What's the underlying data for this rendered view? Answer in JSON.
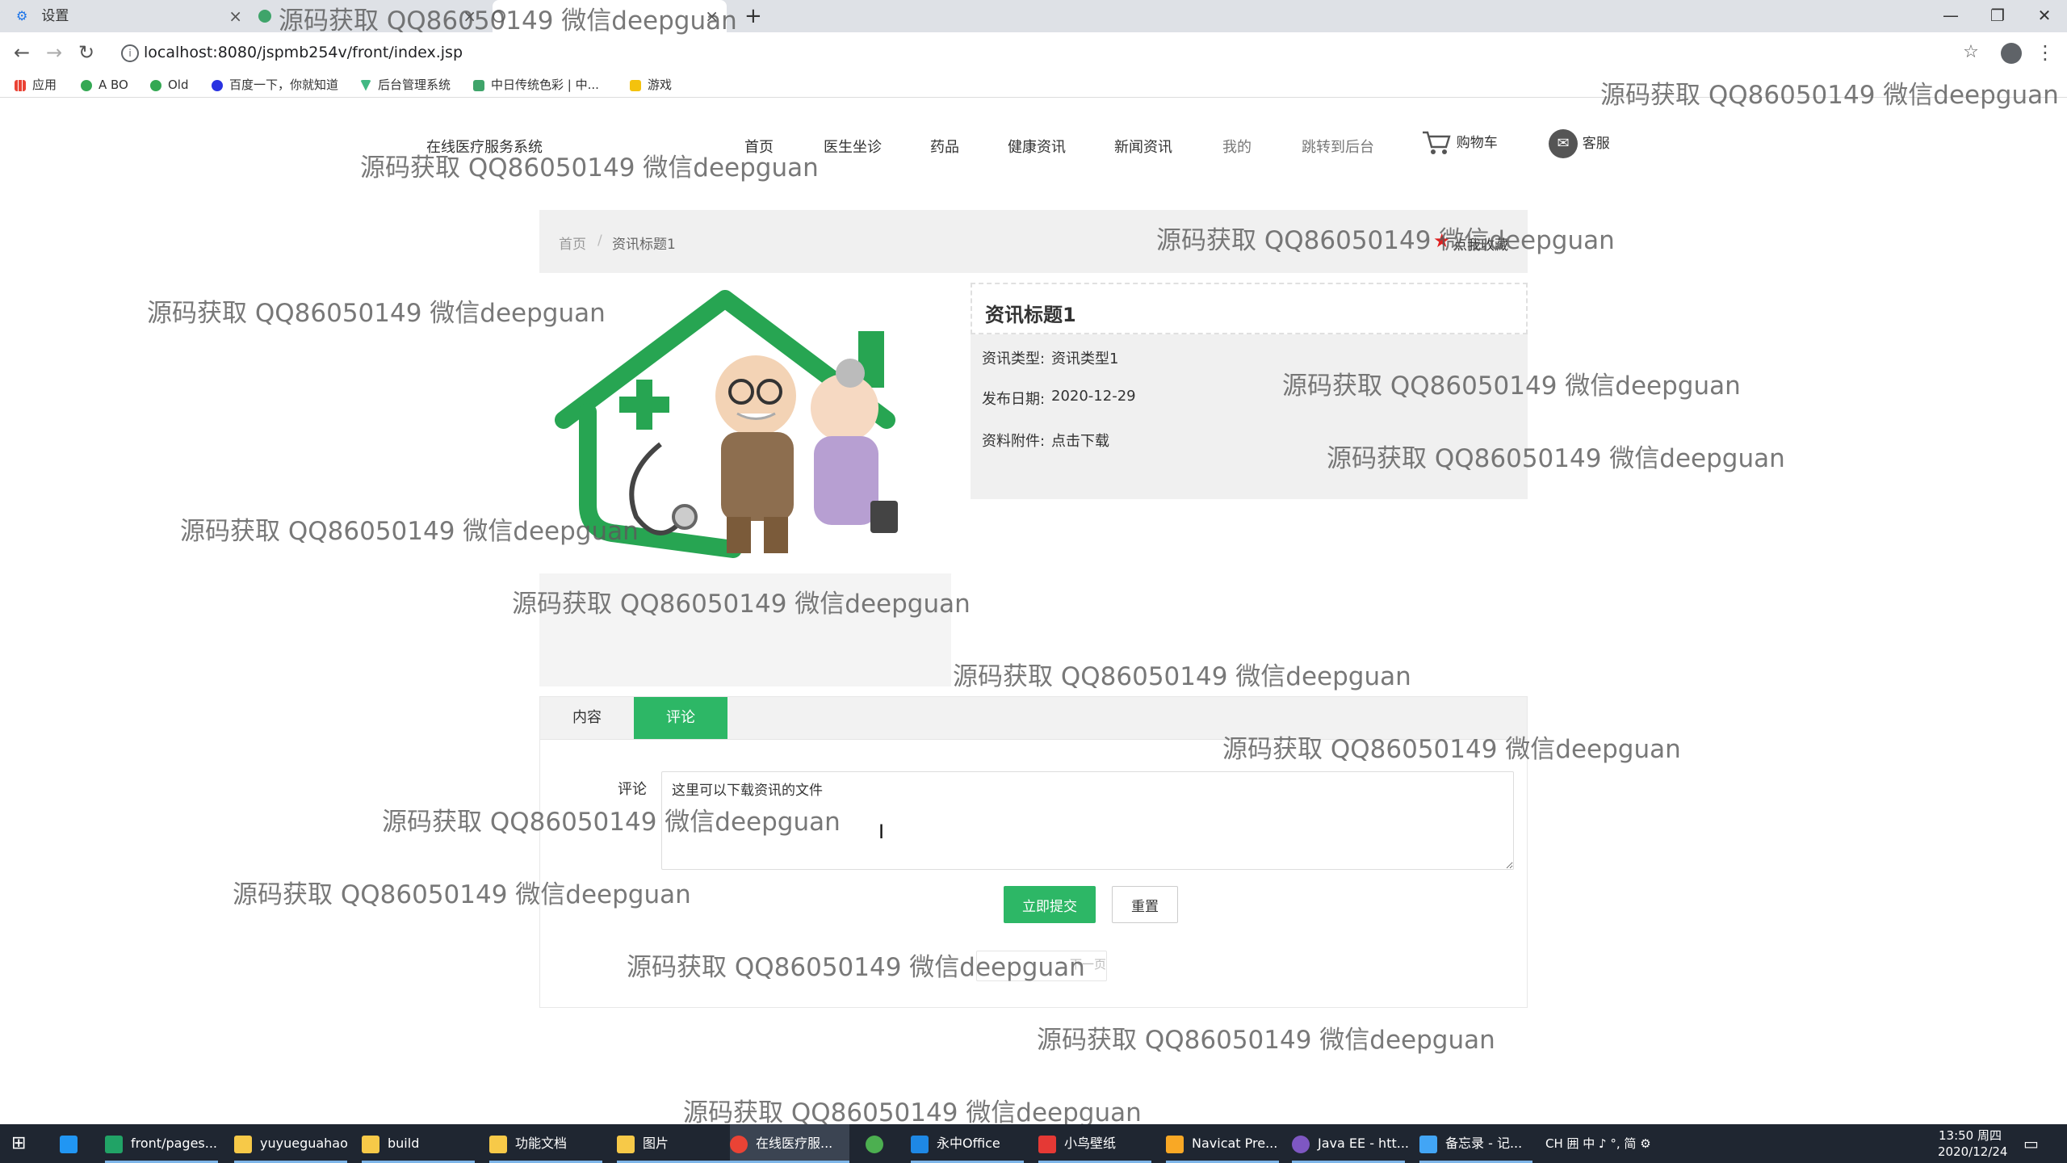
{
  "browser": {
    "tabs": [
      {
        "title": "设置",
        "icon": "gear-icon"
      },
      {
        "title": "",
        "icon": "green-leaf-icon"
      },
      {
        "title": "",
        "icon": "page-icon"
      }
    ],
    "new_tab": "+",
    "window_controls": {
      "minimize": "—",
      "maximize": "❐",
      "close": "✕"
    },
    "url": "localhost:8080/jspmb254v/front/index.jsp",
    "bookmarks": [
      {
        "label": "应用",
        "color": "#4285f4"
      },
      {
        "label": "A BO",
        "color": "#34a853"
      },
      {
        "label": "Old",
        "color": "#34a853"
      },
      {
        "label": "百度一下，你就知道",
        "color": "#2932e1"
      },
      {
        "label": "后台管理系统",
        "color": "#41b883"
      },
      {
        "label": "中日传统色彩 | 中...",
        "color": "#3fa46a"
      },
      {
        "label": "游戏",
        "color": "#f4c20d"
      }
    ]
  },
  "site": {
    "logo": "在线医疗服务系统",
    "nav": [
      "首页",
      "医生坐诊",
      "药品",
      "健康资讯",
      "新闻资讯",
      "我的",
      "跳转到后台"
    ],
    "cart": "购物车",
    "service": "客服"
  },
  "breadcrumb": {
    "home": "首页",
    "sep": "/",
    "current": "资讯标题1",
    "favorite": "点我收藏"
  },
  "article": {
    "title": "资讯标题1",
    "type_label": "资讯类型:",
    "type_value": "资讯类型1",
    "date_label": "发布日期:",
    "date_value": "2020-12-29",
    "attach_label": "资料附件:",
    "attach_value": "点击下载"
  },
  "tabs": {
    "content": "内容",
    "comment": "评论"
  },
  "comment": {
    "label": "评论",
    "value": "这里可以下载资讯的文件",
    "submit": "立即提交",
    "reset": "重置",
    "next_page": "下一页"
  },
  "watermark": "源码获取 QQ86050149 微信deepguan",
  "taskbar": {
    "items": [
      {
        "label": "front/pages...",
        "color": "#21a366"
      },
      {
        "label": "yuyueguahao",
        "color": "#f7c948"
      },
      {
        "label": "build",
        "color": "#f7c948"
      },
      {
        "label": "功能文档",
        "color": "#f7c948"
      },
      {
        "label": "图片",
        "color": "#f7c948"
      },
      {
        "label": "在线医疗服...",
        "color": "#ea4335"
      },
      {
        "label": "",
        "color": "#4caf50"
      },
      {
        "label": "永中Office",
        "color": "#1e88e5"
      },
      {
        "label": "小鸟壁纸",
        "color": "#e53935"
      },
      {
        "label": "Navicat Pre...",
        "color": "#f9a825"
      },
      {
        "label": "Java EE - htt...",
        "color": "#7e57c2"
      },
      {
        "label": "备忘录 - 记...",
        "color": "#42a5f5"
      }
    ],
    "tray": "CH 囲 中 ♪ °, 简 ⚙",
    "time": "13:50 周四",
    "date": "2020/12/24"
  }
}
